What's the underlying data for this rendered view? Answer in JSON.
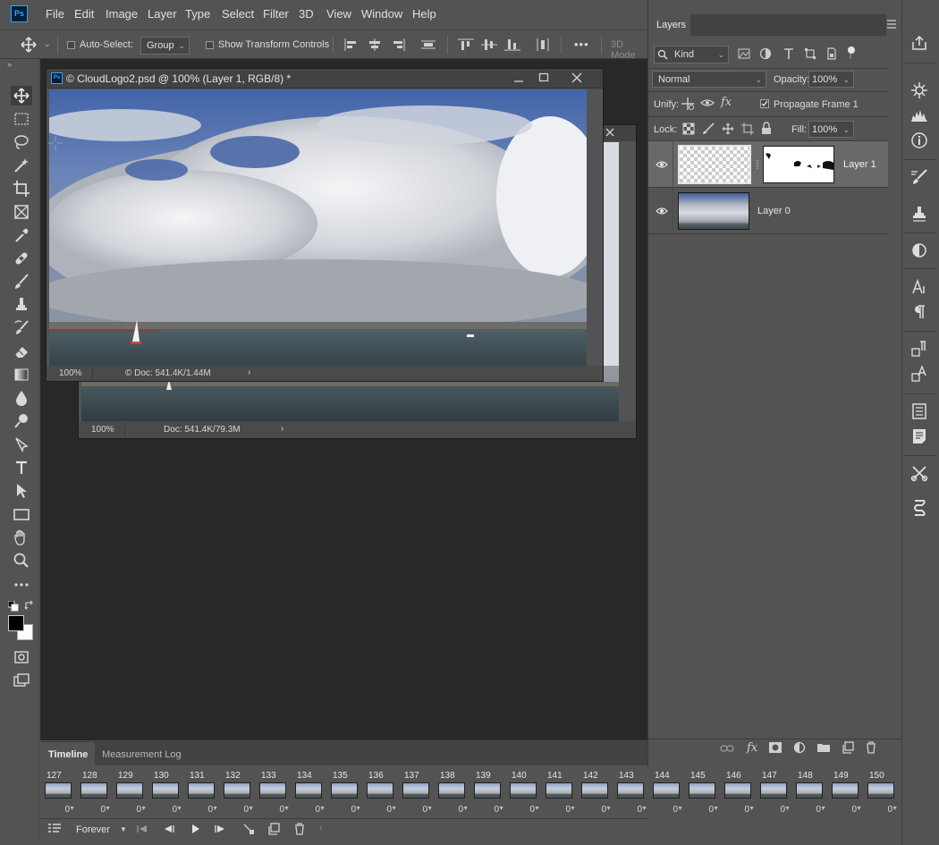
{
  "app": {
    "logo": "Ps"
  },
  "menu": [
    "File",
    "Edit",
    "Image",
    "Layer",
    "Type",
    "Select",
    "Filter",
    "3D",
    "View",
    "Window",
    "Help"
  ],
  "options": {
    "auto_select_label": "Auto-Select:",
    "auto_select_value": "Group",
    "transform_label": "Show Transform Controls",
    "more": "•••",
    "mode_3d": "3D Mode"
  },
  "doc_front": {
    "title": "© CloudLogo2.psd @ 100% (Layer 1, RGB/8) *",
    "zoom": "100%",
    "doc_info": "© Doc: 541.4K/1.44M"
  },
  "doc_back": {
    "zoom": "100%",
    "doc_info": "Doc: 541.4K/79.3M"
  },
  "layers": {
    "tab": "Layers",
    "filter_kind": "Kind",
    "blend_mode": "Normal",
    "opacity_label": "Opacity:",
    "opacity_value": "100%",
    "unify_label": "Unify:",
    "propagate_label": "Propagate Frame 1",
    "lock_label": "Lock:",
    "fill_label": "Fill:",
    "fill_value": "100%",
    "items": [
      {
        "name": "Layer 1"
      },
      {
        "name": "Layer 0"
      }
    ]
  },
  "timeline": {
    "tabs": [
      "Timeline",
      "Measurement Log"
    ],
    "frames": [
      {
        "num": "127",
        "delay": "0"
      },
      {
        "num": "128",
        "delay": "0"
      },
      {
        "num": "129",
        "delay": "0"
      },
      {
        "num": "130",
        "delay": "0"
      },
      {
        "num": "131",
        "delay": "0"
      },
      {
        "num": "132",
        "delay": "0"
      },
      {
        "num": "133",
        "delay": "0"
      },
      {
        "num": "134",
        "delay": "0"
      },
      {
        "num": "135",
        "delay": "0"
      },
      {
        "num": "136",
        "delay": "0"
      },
      {
        "num": "137",
        "delay": "0"
      },
      {
        "num": "138",
        "delay": "0"
      },
      {
        "num": "139",
        "delay": "0"
      },
      {
        "num": "140",
        "delay": "0"
      },
      {
        "num": "141",
        "delay": "0"
      },
      {
        "num": "142",
        "delay": "0"
      },
      {
        "num": "143",
        "delay": "0"
      },
      {
        "num": "144",
        "delay": "0"
      },
      {
        "num": "145",
        "delay": "0"
      },
      {
        "num": "146",
        "delay": "0"
      },
      {
        "num": "147",
        "delay": "0"
      },
      {
        "num": "148",
        "delay": "0"
      },
      {
        "num": "149",
        "delay": "0"
      },
      {
        "num": "150",
        "delay": "0"
      }
    ],
    "loop": "Forever"
  }
}
